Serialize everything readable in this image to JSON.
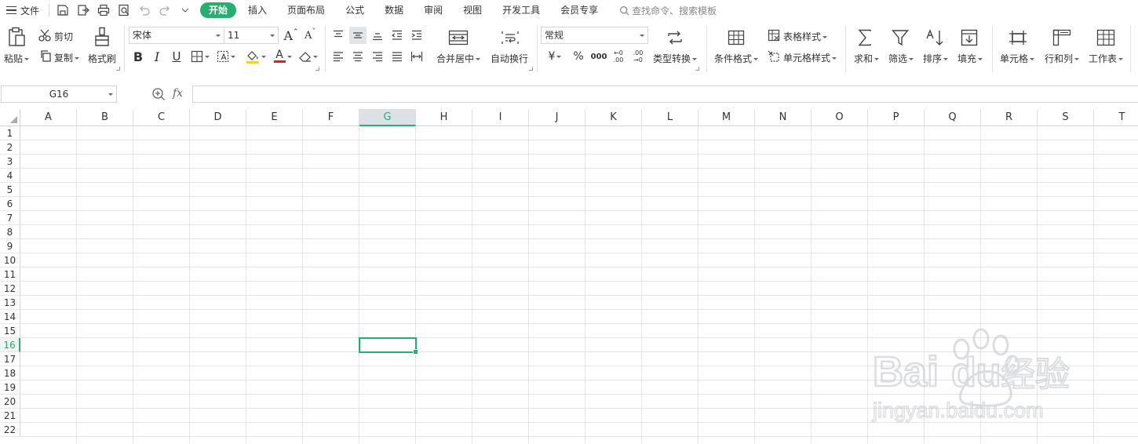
{
  "menu": {
    "file_label": "文件",
    "tabs": [
      {
        "label": "开始",
        "active": true
      },
      {
        "label": "插入"
      },
      {
        "label": "页面布局"
      },
      {
        "label": "公式"
      },
      {
        "label": "数据"
      },
      {
        "label": "审阅"
      },
      {
        "label": "视图"
      },
      {
        "label": "开发工具"
      },
      {
        "label": "会员专享"
      }
    ],
    "search_placeholder": "查找命令、搜索模板"
  },
  "ribbon": {
    "paste": "粘贴",
    "cut": "剪切",
    "copy": "复制",
    "format_painter": "格式刷",
    "font_name": "宋体",
    "font_size": "11",
    "merge_center": "合并居中",
    "wrap_text": "自动换行",
    "number_format": "常规",
    "type_convert": "类型转换",
    "conditional_format": "条件格式",
    "table_style": "表格样式",
    "cell_style": "单元格样式",
    "sum": "求和",
    "filter": "筛选",
    "sort": "排序",
    "fill": "填充",
    "cell": "单元格",
    "row_col": "行和列",
    "worksheet": "工作表",
    "bold": "B",
    "italic": "I",
    "underline": "U",
    "font_color_letter": "A",
    "increase_font": "A",
    "decrease_font": "A",
    "currency": "¥",
    "percent": "%",
    "thousands": "000",
    "inc_decimal": "←0 .00",
    "dec_decimal": ".00 →0"
  },
  "formula_bar": {
    "name_box": "G16",
    "fx": "fx",
    "content": ""
  },
  "sheet": {
    "columns": [
      "A",
      "B",
      "C",
      "D",
      "E",
      "F",
      "G",
      "H",
      "I",
      "J",
      "K",
      "L",
      "M",
      "N",
      "O",
      "P",
      "Q",
      "R",
      "S",
      "T"
    ],
    "rows": [
      "1",
      "2",
      "3",
      "4",
      "5",
      "6",
      "7",
      "8",
      "9",
      "10",
      "11",
      "12",
      "13",
      "14",
      "15",
      "16",
      "17",
      "18",
      "19",
      "20",
      "21",
      "22"
    ],
    "active_column": "G",
    "active_row": "16"
  },
  "watermark": {
    "brand": "Bai",
    "brand2": "du",
    "cn": "经验",
    "url": "jingyan.baidu.com"
  },
  "colors": {
    "accent": "#27ae70",
    "header_bg": "#dde1e6",
    "grid_line": "#e1e4e8"
  }
}
